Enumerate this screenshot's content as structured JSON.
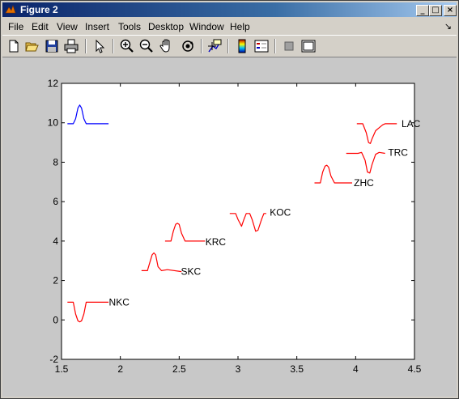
{
  "window": {
    "title": "Figure 2",
    "controls": [
      "_",
      "□",
      "×"
    ]
  },
  "menu": [
    "File",
    "Edit",
    "View",
    "Insert",
    "Tools",
    "Desktop",
    "Window",
    "Help"
  ],
  "toolbar": {
    "icons": [
      "new-figure-icon",
      "open-file-icon",
      "save-icon",
      "print-icon",
      "edit-plot-arrow-icon",
      "zoom-in-icon",
      "zoom-out-icon",
      "pan-hand-icon",
      "rotate-3d-icon",
      "data-cursor-icon",
      "insert-colorbar-icon",
      "insert-legend-icon",
      "hide-plot-tools-icon",
      "show-plot-tools-icon"
    ]
  },
  "colors": {
    "red": "#ff0000",
    "blue": "#0000ff",
    "figure_bg": "#c8c8c8",
    "axes_bg": "#ffffff"
  },
  "chart_data": {
    "type": "line",
    "xlim": [
      1.5,
      4.5
    ],
    "ylim": [
      -2,
      12
    ],
    "xticks": [
      1.5,
      2,
      2.5,
      3,
      3.5,
      4,
      4.5
    ],
    "yticks": [
      -2,
      0,
      2,
      4,
      6,
      8,
      10,
      12
    ],
    "xtick_labels": [
      "1.5",
      "2",
      "2.5",
      "3",
      "3.5",
      "4",
      "4.5"
    ],
    "ytick_labels": [
      "-2",
      "0",
      "2",
      "4",
      "6",
      "8",
      "10",
      "12"
    ],
    "grid": false,
    "series": [
      {
        "name": "",
        "color": "blue",
        "x": [
          1.55,
          1.6,
          1.62,
          1.64,
          1.655,
          1.67,
          1.69,
          1.71,
          1.73,
          1.9
        ],
        "y": [
          9.95,
          9.95,
          10.2,
          10.75,
          10.9,
          10.75,
          10.2,
          9.95,
          9.95,
          9.95
        ]
      },
      {
        "name": "NKC",
        "color": "red",
        "x": [
          1.55,
          1.6,
          1.62,
          1.64,
          1.655,
          1.67,
          1.69,
          1.71,
          1.9
        ],
        "y": [
          0.9,
          0.9,
          0.3,
          -0.05,
          -0.1,
          -0.05,
          0.3,
          0.9,
          0.9
        ]
      },
      {
        "name": "SKC",
        "color": "red",
        "x": [
          2.18,
          2.23,
          2.25,
          2.27,
          2.285,
          2.3,
          2.32,
          2.35,
          2.4,
          2.52
        ],
        "y": [
          2.5,
          2.5,
          2.9,
          3.3,
          3.4,
          3.3,
          2.7,
          2.5,
          2.55,
          2.45
        ]
      },
      {
        "name": "KRC",
        "color": "red",
        "x": [
          2.38,
          2.43,
          2.45,
          2.47,
          2.485,
          2.5,
          2.52,
          2.55,
          2.72
        ],
        "y": [
          4.0,
          4.0,
          4.5,
          4.85,
          4.9,
          4.85,
          4.4,
          4.0,
          4.0
        ]
      },
      {
        "name": "KOC",
        "color": "red",
        "x": [
          2.93,
          2.98,
          3.0,
          3.03,
          3.05,
          3.07,
          3.1,
          3.12,
          3.15,
          3.17,
          3.2,
          3.22,
          3.24
        ],
        "y": [
          5.4,
          5.4,
          5.1,
          4.75,
          5.1,
          5.4,
          5.4,
          5.1,
          4.5,
          4.55,
          5.1,
          5.4,
          5.4
        ]
      },
      {
        "name": "ZHC",
        "color": "red",
        "x": [
          3.65,
          3.7,
          3.72,
          3.74,
          3.755,
          3.77,
          3.79,
          3.82,
          3.97
        ],
        "y": [
          6.95,
          6.95,
          7.5,
          7.8,
          7.85,
          7.75,
          7.3,
          6.95,
          6.95
        ]
      },
      {
        "name": "TRC",
        "color": "red",
        "x": [
          3.92,
          4.02,
          4.05,
          4.08,
          4.1,
          4.12,
          4.14,
          4.17,
          4.2,
          4.25
        ],
        "y": [
          8.45,
          8.45,
          8.5,
          8.1,
          7.5,
          7.45,
          7.9,
          8.4,
          8.5,
          8.45
        ]
      },
      {
        "name": "LAC",
        "color": "red",
        "x": [
          4.01,
          4.06,
          4.09,
          4.11,
          4.125,
          4.14,
          4.17,
          4.2,
          4.23,
          4.25,
          4.35
        ],
        "y": [
          9.95,
          9.95,
          9.5,
          9.0,
          8.95,
          9.2,
          9.6,
          9.75,
          9.9,
          9.95,
          9.95
        ]
      }
    ],
    "labels": [
      {
        "text": "NKC",
        "x": 1.99,
        "y": 0.9
      },
      {
        "text": "SKC",
        "x": 2.6,
        "y": 2.45
      },
      {
        "text": "KRC",
        "x": 2.81,
        "y": 3.95
      },
      {
        "text": "KOC",
        "x": 3.36,
        "y": 5.45
      },
      {
        "text": "ZHC",
        "x": 4.07,
        "y": 6.95
      },
      {
        "text": "TRC",
        "x": 4.36,
        "y": 8.5
      },
      {
        "text": "LAC",
        "x": 4.47,
        "y": 9.95
      }
    ]
  }
}
